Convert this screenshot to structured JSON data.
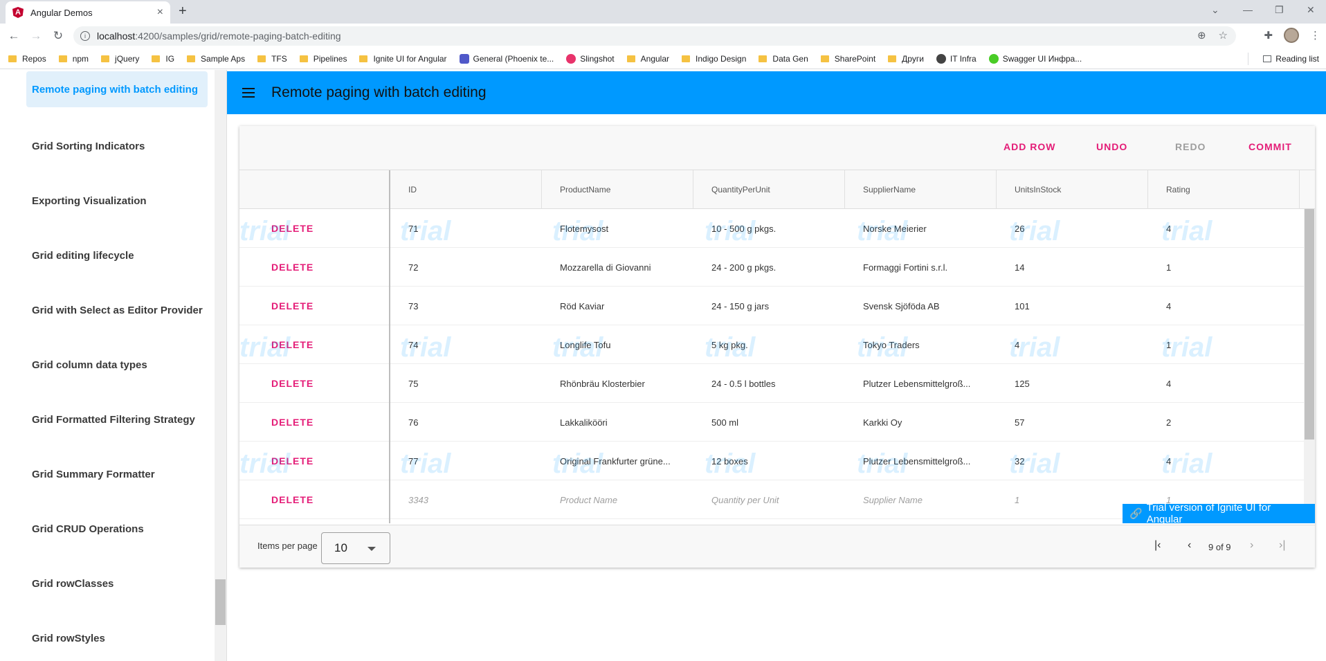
{
  "browser": {
    "tab_title": "Angular Demos",
    "tab_close": "×",
    "new_tab": "+",
    "url_host": "localhost",
    "url_path": ":4200/samples/grid/remote-paging-batch-editing",
    "reading_list": "Reading list",
    "bookmarks": [
      "Repos",
      "npm",
      "jQuery",
      "IG",
      "Sample Aps",
      "TFS",
      "Pipelines",
      "Ignite UI for Angular",
      "General (Phoenix te...",
      "Slingshot",
      "Angular",
      "Indigo Design",
      "Data Gen",
      "SharePoint",
      "Други",
      "IT Infra",
      "Swagger UI Инфра..."
    ]
  },
  "sidebar": {
    "items": [
      {
        "label": "Remote paging with batch editing",
        "active": true
      },
      {
        "label": "Grid Sorting Indicators"
      },
      {
        "label": "Exporting Visualization"
      },
      {
        "label": "Grid editing lifecycle"
      },
      {
        "label": "Grid with Select as Editor Provider"
      },
      {
        "label": "Grid column data types"
      },
      {
        "label": "Grid Formatted Filtering Strategy"
      },
      {
        "label": "Grid Summary Formatter"
      },
      {
        "label": "Grid CRUD Operations"
      },
      {
        "label": "Grid rowClasses"
      },
      {
        "label": "Grid rowStyles"
      }
    ]
  },
  "appbar": {
    "title": "Remote paging with batch editing"
  },
  "grid": {
    "toolbar": {
      "add_row": "ADD ROW",
      "undo": "UNDO",
      "redo": "REDO",
      "commit": "COMMIT"
    },
    "columns": [
      "ID",
      "ProductName",
      "QuantityPerUnit",
      "SupplierName",
      "UnitsInStock",
      "Rating"
    ],
    "delete_label": "DELETE",
    "watermark": "trial",
    "rows": [
      {
        "id": "71",
        "product": "Flotemysost",
        "qty": "10 - 500 g pkgs.",
        "supplier": "Norske Meierier",
        "stock": "26",
        "rating": "4"
      },
      {
        "id": "72",
        "product": "Mozzarella di Giovanni",
        "qty": "24 - 200 g pkgs.",
        "supplier": "Formaggi Fortini s.r.l.",
        "stock": "14",
        "rating": "1"
      },
      {
        "id": "73",
        "product": "Röd Kaviar",
        "qty": "24 - 150 g jars",
        "supplier": "Svensk Sjöföda AB",
        "stock": "101",
        "rating": "4"
      },
      {
        "id": "74",
        "product": "Longlife Tofu",
        "qty": "5 kg pkg.",
        "supplier": "Tokyo Traders",
        "stock": "4",
        "rating": "1"
      },
      {
        "id": "75",
        "product": "Rhönbräu Klosterbier",
        "qty": "24 - 0.5 l bottles",
        "supplier": "Plutzer Lebensmittelgroß...",
        "stock": "125",
        "rating": "4"
      },
      {
        "id": "76",
        "product": "Lakkalikööri",
        "qty": "500 ml",
        "supplier": "Karkki Oy",
        "stock": "57",
        "rating": "2"
      },
      {
        "id": "77",
        "product": "Original Frankfurter grüne...",
        "qty": "12 boxes",
        "supplier": "Plutzer Lebensmittelgroß...",
        "stock": "32",
        "rating": "4"
      }
    ],
    "new_row": {
      "id": "3343",
      "product": "Product Name",
      "qty": "Quantity per Unit",
      "supplier": "Supplier Name",
      "stock": "1",
      "rating": "1"
    },
    "trial_badge": "Trial version of Ignite UI for Angular",
    "pager": {
      "items_per_page_label": "Items per page",
      "items_per_page": "10",
      "page_text": "9 of 9"
    }
  }
}
